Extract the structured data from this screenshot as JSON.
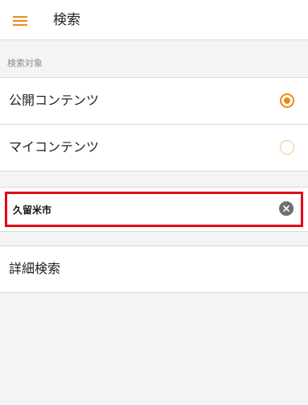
{
  "header": {
    "title": "検索",
    "menu_icon": "hamburger-menu-icon"
  },
  "search_target": {
    "label": "検索対象",
    "options": [
      {
        "label": "公開コンテンツ",
        "selected": true
      },
      {
        "label": "マイコンテンツ",
        "selected": false
      }
    ]
  },
  "search": {
    "value": "久留米市",
    "clear_icon": "clear-icon"
  },
  "advanced_search": {
    "label": "詳細検索"
  },
  "colors": {
    "accent": "#f08a12",
    "highlight_border": "#e30613",
    "background": "#f4f4f4"
  }
}
